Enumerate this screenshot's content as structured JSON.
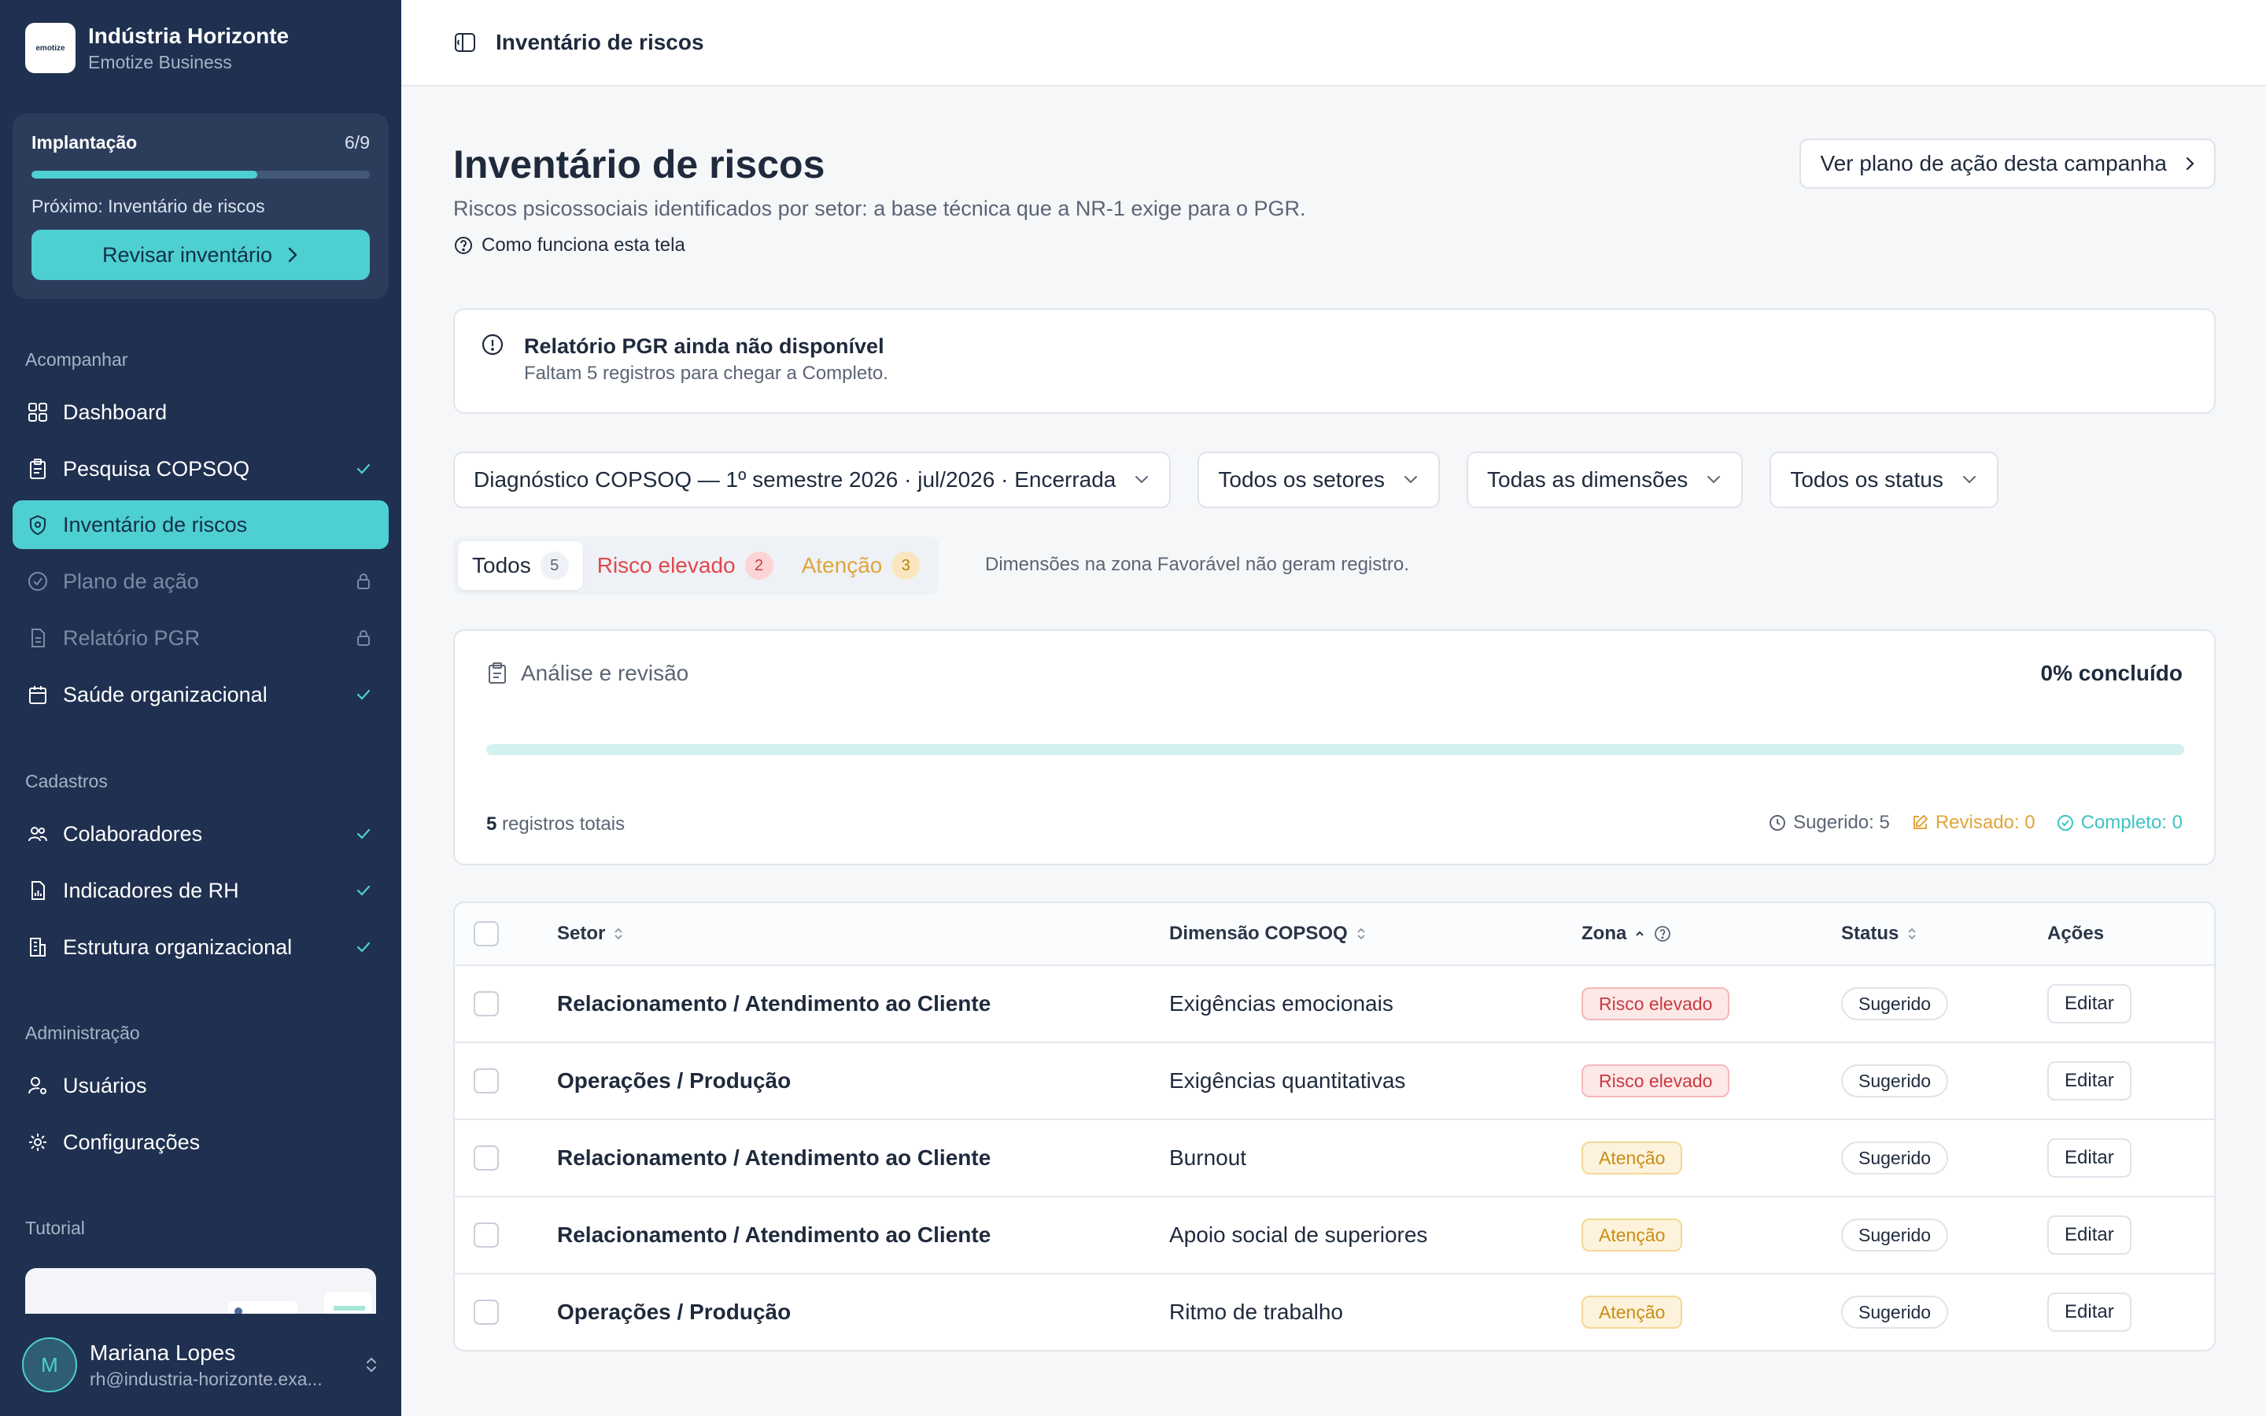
{
  "org": {
    "name": "Indústria Horizonte",
    "plan": "Emotize Business",
    "logo_text": "emotize"
  },
  "implantacao": {
    "title": "Implantação",
    "count": "6/9",
    "progress": 0.667,
    "next": "Próximo: Inventário de riscos",
    "button": "Revisar inventário"
  },
  "nav": {
    "section_acompanhar": "Acompanhar",
    "section_cadastros": "Cadastros",
    "section_admin": "Administração",
    "section_tutorial": "Tutorial",
    "items": [
      {
        "label": "Dashboard"
      },
      {
        "label": "Pesquisa COPSOQ"
      },
      {
        "label": "Inventário de riscos"
      },
      {
        "label": "Plano de ação"
      },
      {
        "label": "Relatório PGR"
      },
      {
        "label": "Saúde organizacional"
      },
      {
        "label": "Colaboradores"
      },
      {
        "label": "Indicadores de RH"
      },
      {
        "label": "Estrutura organizacional"
      },
      {
        "label": "Usuários"
      },
      {
        "label": "Configurações"
      }
    ]
  },
  "user": {
    "initial": "M",
    "name": "Mariana Lopes",
    "email": "rh@industria-horizonte.exa..."
  },
  "topbar": {
    "breadcrumb": "Inventário de riscos"
  },
  "page": {
    "title": "Inventário de riscos",
    "subtitle": "Riscos psicossociais identificados por setor: a base técnica que a NR-1 exige para o PGR.",
    "help": "Como funciona esta tela",
    "plan_button": "Ver plano de ação desta campanha"
  },
  "alert": {
    "title": "Relatório PGR ainda não disponível",
    "text": "Faltam 5 registros para chegar a Completo."
  },
  "filters": {
    "campaign": "Diagnóstico COPSOQ — 1º semestre 2026 · jul/2026 · Encerrada",
    "sectors": "Todos os setores",
    "dimensions": "Todas as dimensões",
    "status": "Todos os status"
  },
  "segments": {
    "all": {
      "label": "Todos",
      "count": "5"
    },
    "high": {
      "label": "Risco elevado",
      "count": "2"
    },
    "attention": {
      "label": "Atenção",
      "count": "3"
    },
    "note": "Dimensões na zona Favorável não geram registro."
  },
  "analysis": {
    "title": "Análise e revisão",
    "percent": "0% concluído",
    "progress": 0,
    "total_count": "5",
    "total_label": "registros totais",
    "suggested": "Sugerido: 5",
    "reviewed": "Revisado: 0",
    "complete": "Completo: 0"
  },
  "table": {
    "headers": {
      "setor": "Setor",
      "dimensao": "Dimensão COPSOQ",
      "zona": "Zona",
      "status": "Status",
      "acoes": "Ações"
    },
    "edit_label": "Editar",
    "rows": [
      {
        "setor": "Relacionamento / Atendimento ao Cliente",
        "dimensao": "Exigências emocionais",
        "zona": "Risco elevado",
        "status": "Sugerido"
      },
      {
        "setor": "Operações / Produção",
        "dimensao": "Exigências quantitativas",
        "zona": "Risco elevado",
        "status": "Sugerido"
      },
      {
        "setor": "Relacionamento / Atendimento ao Cliente",
        "dimensao": "Burnout",
        "zona": "Atenção",
        "status": "Sugerido"
      },
      {
        "setor": "Relacionamento / Atendimento ao Cliente",
        "dimensao": "Apoio social de superiores",
        "zona": "Atenção",
        "status": "Sugerido"
      },
      {
        "setor": "Operações / Produção",
        "dimensao": "Ritmo de trabalho",
        "zona": "Atenção",
        "status": "Sugerido"
      }
    ]
  },
  "colors": {
    "sidebar": "#1f3050",
    "accent": "#4ecfd2",
    "danger": "#e0474c",
    "warning": "#e0a53a"
  }
}
